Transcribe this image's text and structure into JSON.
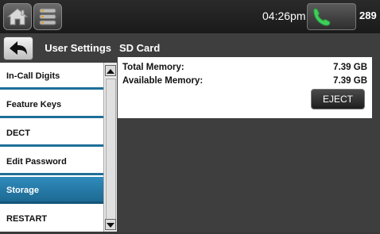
{
  "topbar": {
    "time": "04:26pm",
    "extension": "289",
    "icons": [
      "home-icon",
      "menu-icon",
      "phone-icon"
    ]
  },
  "header": {
    "breadcrumb": "User Settings",
    "title": "SD Card"
  },
  "sidebar": {
    "items": [
      {
        "label": "In-Call Digits",
        "active": false
      },
      {
        "label": "Feature Keys",
        "active": false
      },
      {
        "label": "DECT",
        "active": false
      },
      {
        "label": "Edit Password",
        "active": false
      },
      {
        "label": "Storage",
        "active": true
      },
      {
        "label": "RESTART",
        "active": false
      }
    ]
  },
  "sd_card": {
    "total_label": "Total Memory:",
    "total_value": "7.39 GB",
    "available_label": "Available Memory:",
    "available_value": "7.39 GB",
    "eject_label": "EJECT"
  },
  "colors": {
    "accent": "#1f6f99",
    "active_item": "#2f8bbd",
    "phone_icon": "#3ecf5a"
  }
}
